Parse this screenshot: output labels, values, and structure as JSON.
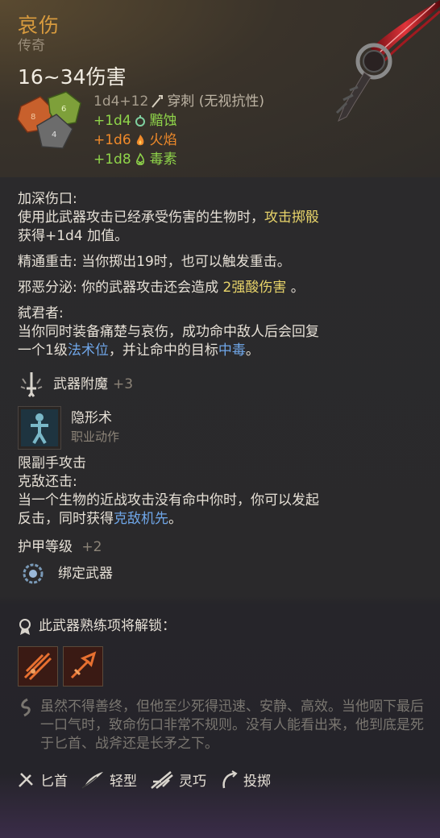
{
  "item": {
    "name": "哀伤",
    "rarity": "传奇",
    "damage": "16~34伤害",
    "base_roll": "1d4+12",
    "base_type": "穿刺 (无视抗性)",
    "bonus_rolls": [
      {
        "roll": "+1d4",
        "type": "黯蚀",
        "icon": "necrotic-icon"
      },
      {
        "roll": "+1d6",
        "type": "火焰",
        "icon": "fire-icon"
      },
      {
        "roll": "+1d8",
        "type": "毒素",
        "icon": "poison-icon"
      }
    ]
  },
  "abilities": {
    "deep_wound_title": "加深伤口:",
    "deep_wound_text1": "使用此武器攻击已经承受伤害的生物时，",
    "deep_wound_highlight": "攻击掷骰",
    "deep_wound_text2": "获得+1d4 加值。",
    "crit_label": "精通重击:",
    "crit_text": " 当你掷出19时，也可以触发重击。",
    "evil_label": "邪恶分泌:",
    "evil_text": " 你的武器攻击还会造成 ",
    "evil_highlight": "2强酸伤害",
    "evil_end": " 。",
    "regicide_title": "弑君者:",
    "regicide_text1": "当你同时装备痛楚与哀伤，成功命中敌人后会回复",
    "regicide_text2a": "一个1级",
    "regicide_highlight1": "法术位",
    "regicide_text2b": "，并让命中的目标",
    "regicide_highlight2": "中毒",
    "regicide_text2c": "。",
    "enchant_label": "武器附魔",
    "enchant_bonus": "+3",
    "spell_name": "隐形术",
    "spell_type": "职业动作",
    "offhand": "限副手攻击",
    "riposte_title": "克敌还击:",
    "riposte_text1": "当一个生物的近战攻击没有命中你时，你可以发起",
    "riposte_text2a": "反击，同时获得",
    "riposte_highlight": "克敌机先",
    "riposte_text2b": "。",
    "ac_label": "护甲等级",
    "ac_bonus": "+2",
    "bind_label": "绑定武器"
  },
  "proficiency": {
    "title": "此武器熟练项将解锁："
  },
  "flavor": {
    "text": "虽然不得善终，但他至少死得迅速、安静、高效。当他咽下最后一口气时，致命伤口非常不规则。没有人能看出来，他到底是死于匕首、战斧还是长矛之下。"
  },
  "tags": [
    {
      "label": "匕首",
      "icon": "dagger-icon"
    },
    {
      "label": "轻型",
      "icon": "feather-icon"
    },
    {
      "label": "灵巧",
      "icon": "finesse-icon"
    },
    {
      "label": "投掷",
      "icon": "throw-icon"
    }
  ],
  "colors": {
    "title": "#d79a3e",
    "highlight": "#e8d46a",
    "keyword": "#6fa6e8",
    "green_roll": "#8fd44a",
    "orange_roll": "#f08a2a"
  }
}
